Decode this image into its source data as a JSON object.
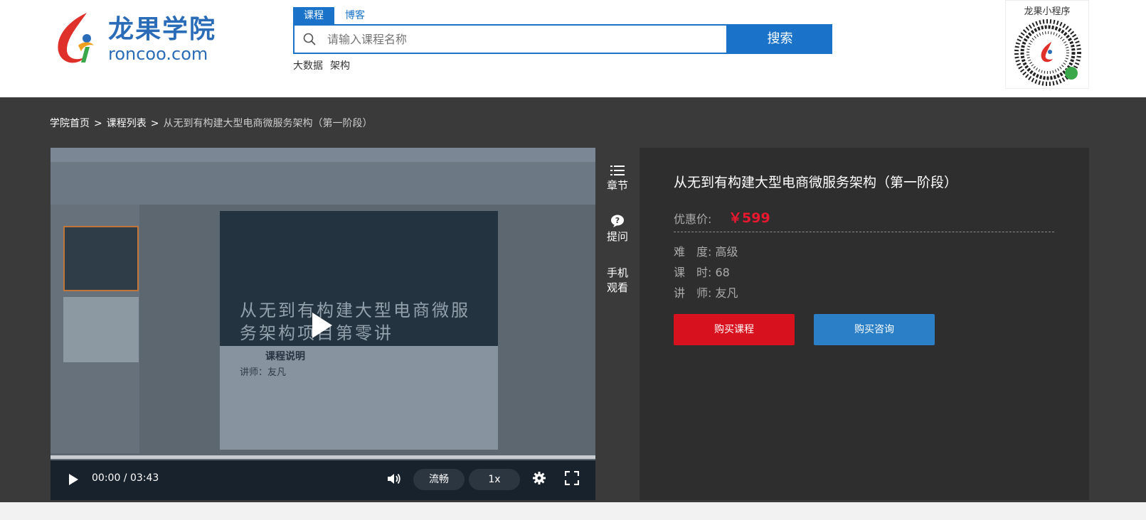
{
  "brand": {
    "name_cn": "龙果学院",
    "name_en": "roncoo.com",
    "accent": "#1a73c8",
    "logo_red": "#e0302a"
  },
  "search": {
    "tabs": [
      "课程",
      "博客"
    ],
    "active_tab": "课程",
    "placeholder": "请输入课程名称",
    "button_label": "搜索",
    "hot_words": [
      "大数据",
      "架构"
    ]
  },
  "qr": {
    "title": "龙果小程序"
  },
  "breadcrumb": {
    "home": "学院首页",
    "list": "课程列表",
    "current": "从无到有构建大型电商微服务架构（第一阶段）",
    "separator": ">"
  },
  "player": {
    "slide_title": "从无到有构建大型电商微服务架构项目第零讲",
    "slide_subtitle": "课程说明",
    "slide_teacher": "讲师：友凡",
    "time_current": "00:00",
    "time_total": "03:43",
    "quality": "流畅",
    "speed": "1x",
    "progress": 0
  },
  "side_nav": {
    "chapters": "章节",
    "ask": "提问",
    "mobile_line1": "手机",
    "mobile_line2": "观看"
  },
  "course": {
    "title": "从无到有构建大型电商微服务架构（第一阶段）",
    "price_label": "优惠价:",
    "price": "￥599",
    "difficulty_label": "难　度:",
    "difficulty": "高级",
    "hours_label": "课　时:",
    "hours": "68",
    "teacher_label": "讲　师:",
    "teacher": "友凡",
    "buy_label": "购买课程",
    "consult_label": "购买咨询"
  }
}
